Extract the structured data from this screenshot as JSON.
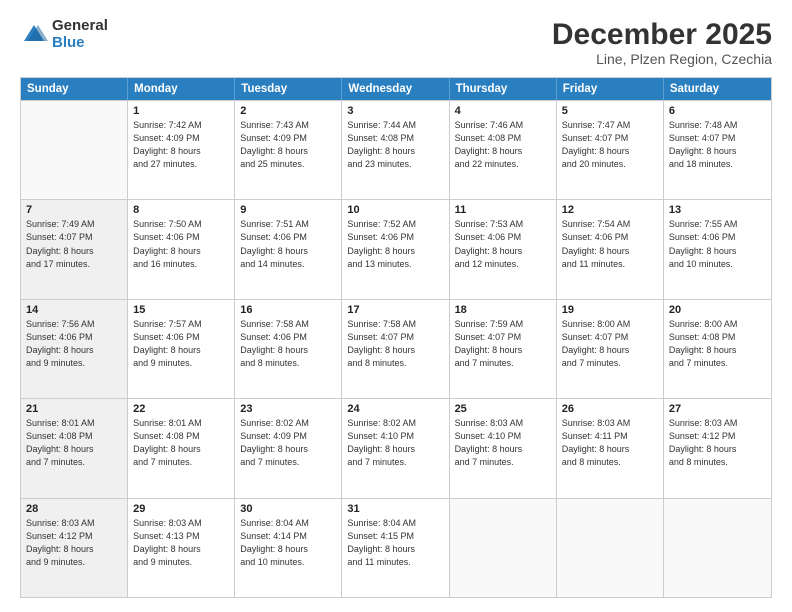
{
  "logo": {
    "general": "General",
    "blue": "Blue"
  },
  "title": "December 2025",
  "location": "Line, Plzen Region, Czechia",
  "header": {
    "days": [
      "Sunday",
      "Monday",
      "Tuesday",
      "Wednesday",
      "Thursday",
      "Friday",
      "Saturday"
    ]
  },
  "weeks": [
    [
      {
        "day": "",
        "info": "",
        "empty": true
      },
      {
        "day": "1",
        "info": "Sunrise: 7:42 AM\nSunset: 4:09 PM\nDaylight: 8 hours\nand 27 minutes."
      },
      {
        "day": "2",
        "info": "Sunrise: 7:43 AM\nSunset: 4:09 PM\nDaylight: 8 hours\nand 25 minutes."
      },
      {
        "day": "3",
        "info": "Sunrise: 7:44 AM\nSunset: 4:08 PM\nDaylight: 8 hours\nand 23 minutes."
      },
      {
        "day": "4",
        "info": "Sunrise: 7:46 AM\nSunset: 4:08 PM\nDaylight: 8 hours\nand 22 minutes."
      },
      {
        "day": "5",
        "info": "Sunrise: 7:47 AM\nSunset: 4:07 PM\nDaylight: 8 hours\nand 20 minutes."
      },
      {
        "day": "6",
        "info": "Sunrise: 7:48 AM\nSunset: 4:07 PM\nDaylight: 8 hours\nand 18 minutes."
      }
    ],
    [
      {
        "day": "7",
        "info": "Sunrise: 7:49 AM\nSunset: 4:07 PM\nDaylight: 8 hours\nand 17 minutes.",
        "shaded": true
      },
      {
        "day": "8",
        "info": "Sunrise: 7:50 AM\nSunset: 4:06 PM\nDaylight: 8 hours\nand 16 minutes."
      },
      {
        "day": "9",
        "info": "Sunrise: 7:51 AM\nSunset: 4:06 PM\nDaylight: 8 hours\nand 14 minutes."
      },
      {
        "day": "10",
        "info": "Sunrise: 7:52 AM\nSunset: 4:06 PM\nDaylight: 8 hours\nand 13 minutes."
      },
      {
        "day": "11",
        "info": "Sunrise: 7:53 AM\nSunset: 4:06 PM\nDaylight: 8 hours\nand 12 minutes."
      },
      {
        "day": "12",
        "info": "Sunrise: 7:54 AM\nSunset: 4:06 PM\nDaylight: 8 hours\nand 11 minutes."
      },
      {
        "day": "13",
        "info": "Sunrise: 7:55 AM\nSunset: 4:06 PM\nDaylight: 8 hours\nand 10 minutes."
      }
    ],
    [
      {
        "day": "14",
        "info": "Sunrise: 7:56 AM\nSunset: 4:06 PM\nDaylight: 8 hours\nand 9 minutes.",
        "shaded": true
      },
      {
        "day": "15",
        "info": "Sunrise: 7:57 AM\nSunset: 4:06 PM\nDaylight: 8 hours\nand 9 minutes."
      },
      {
        "day": "16",
        "info": "Sunrise: 7:58 AM\nSunset: 4:06 PM\nDaylight: 8 hours\nand 8 minutes."
      },
      {
        "day": "17",
        "info": "Sunrise: 7:58 AM\nSunset: 4:07 PM\nDaylight: 8 hours\nand 8 minutes."
      },
      {
        "day": "18",
        "info": "Sunrise: 7:59 AM\nSunset: 4:07 PM\nDaylight: 8 hours\nand 7 minutes."
      },
      {
        "day": "19",
        "info": "Sunrise: 8:00 AM\nSunset: 4:07 PM\nDaylight: 8 hours\nand 7 minutes."
      },
      {
        "day": "20",
        "info": "Sunrise: 8:00 AM\nSunset: 4:08 PM\nDaylight: 8 hours\nand 7 minutes."
      }
    ],
    [
      {
        "day": "21",
        "info": "Sunrise: 8:01 AM\nSunset: 4:08 PM\nDaylight: 8 hours\nand 7 minutes.",
        "shaded": true
      },
      {
        "day": "22",
        "info": "Sunrise: 8:01 AM\nSunset: 4:08 PM\nDaylight: 8 hours\nand 7 minutes."
      },
      {
        "day": "23",
        "info": "Sunrise: 8:02 AM\nSunset: 4:09 PM\nDaylight: 8 hours\nand 7 minutes."
      },
      {
        "day": "24",
        "info": "Sunrise: 8:02 AM\nSunset: 4:10 PM\nDaylight: 8 hours\nand 7 minutes."
      },
      {
        "day": "25",
        "info": "Sunrise: 8:03 AM\nSunset: 4:10 PM\nDaylight: 8 hours\nand 7 minutes."
      },
      {
        "day": "26",
        "info": "Sunrise: 8:03 AM\nSunset: 4:11 PM\nDaylight: 8 hours\nand 8 minutes."
      },
      {
        "day": "27",
        "info": "Sunrise: 8:03 AM\nSunset: 4:12 PM\nDaylight: 8 hours\nand 8 minutes."
      }
    ],
    [
      {
        "day": "28",
        "info": "Sunrise: 8:03 AM\nSunset: 4:12 PM\nDaylight: 8 hours\nand 9 minutes.",
        "shaded": true
      },
      {
        "day": "29",
        "info": "Sunrise: 8:03 AM\nSunset: 4:13 PM\nDaylight: 8 hours\nand 9 minutes."
      },
      {
        "day": "30",
        "info": "Sunrise: 8:04 AM\nSunset: 4:14 PM\nDaylight: 8 hours\nand 10 minutes."
      },
      {
        "day": "31",
        "info": "Sunrise: 8:04 AM\nSunset: 4:15 PM\nDaylight: 8 hours\nand 11 minutes."
      },
      {
        "day": "",
        "info": "",
        "empty": true
      },
      {
        "day": "",
        "info": "",
        "empty": true
      },
      {
        "day": "",
        "info": "",
        "empty": true
      }
    ]
  ]
}
